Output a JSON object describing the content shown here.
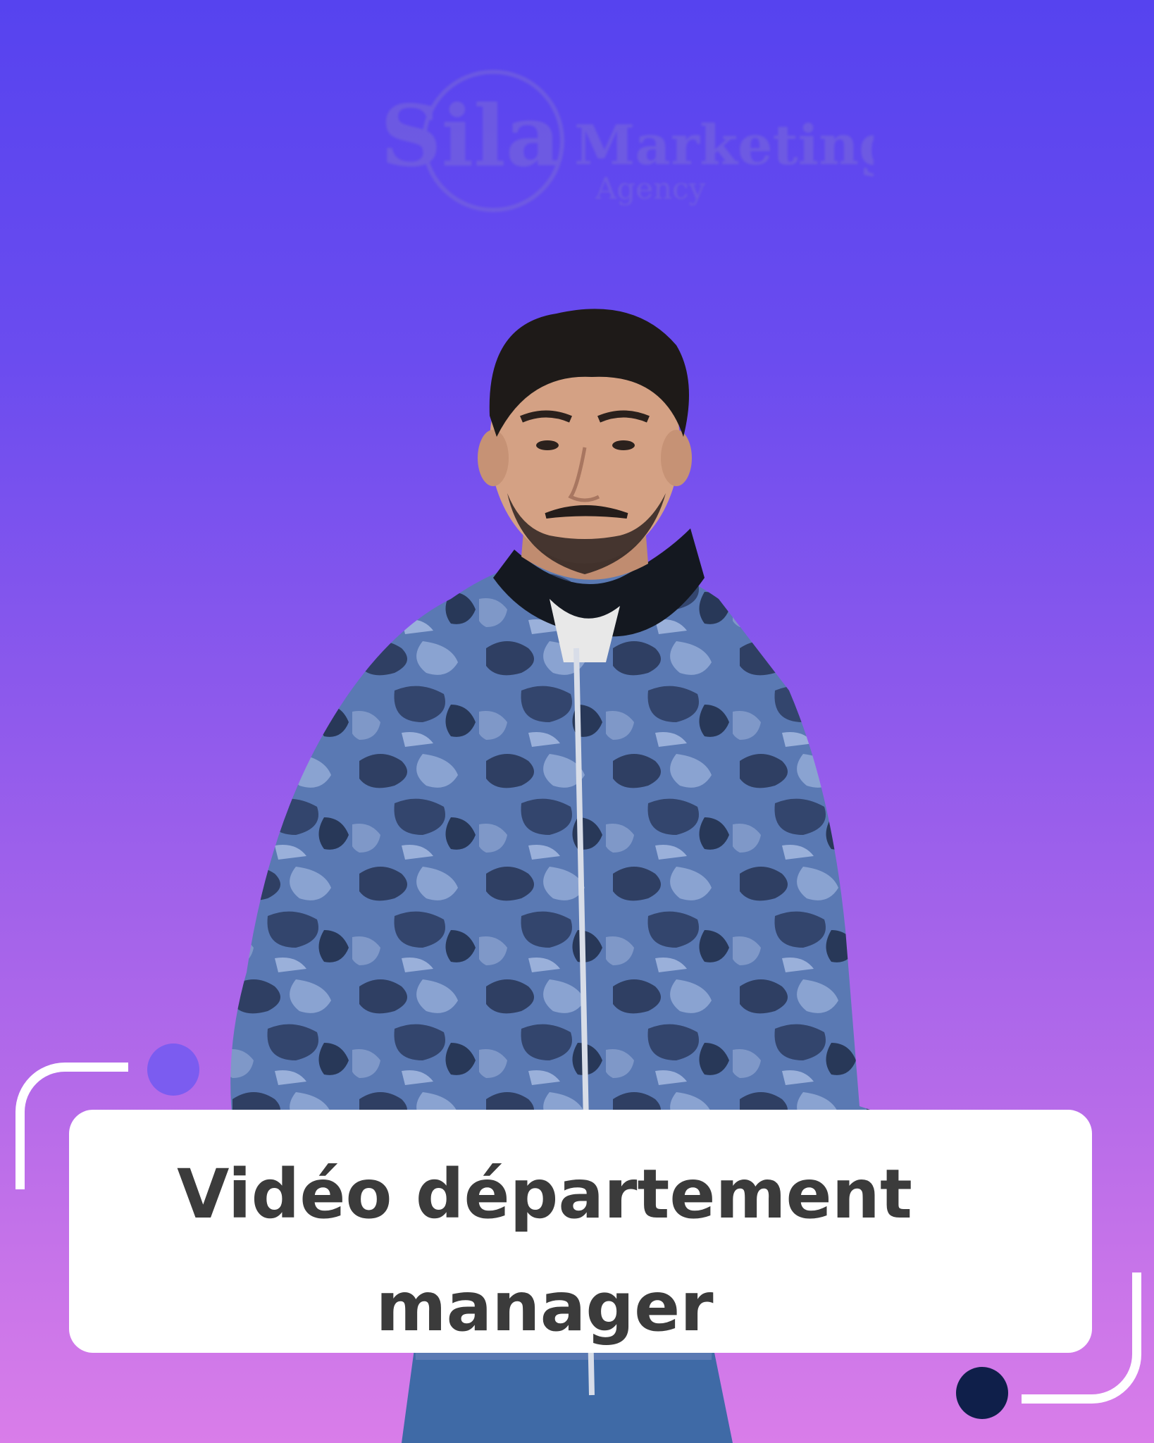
{
  "logo": {
    "brand": "Sila",
    "word": "Marketing",
    "sub": "Agency"
  },
  "title": {
    "line1": "Vidéo département",
    "line2": "manager"
  },
  "colors": {
    "gradient_top": "#5643ef",
    "gradient_bottom": "#d97de9",
    "card": "#ffffff",
    "title_text": "#3b3b3b",
    "dot_purple": "#7b5cf0",
    "dot_navy": "#0f1f4a",
    "jacket": "#5a79b3"
  },
  "icons": {
    "person": "man-in-camo-jacket-photo",
    "dots": "decorative-circle"
  }
}
